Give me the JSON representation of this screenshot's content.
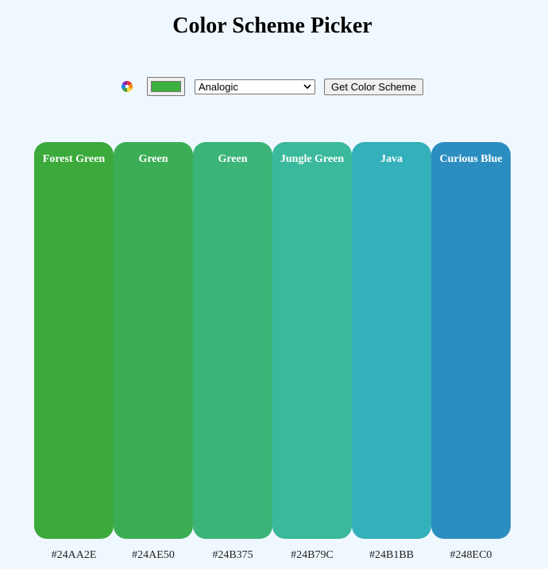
{
  "page": {
    "title": "Color Scheme Picker"
  },
  "controls": {
    "icon": "color-wheel-icon",
    "color_value": "#3BAF3F",
    "mode_selected": "Analogic",
    "button_label": "Get Color Scheme"
  },
  "scheme": {
    "colors": [
      {
        "name": "Forest Green",
        "hex": "#24AA2E",
        "swatch": "#3BAA3B"
      },
      {
        "name": "Green",
        "hex": "#24AE50",
        "swatch": "#3BAE55"
      },
      {
        "name": "Green",
        "hex": "#24B375",
        "swatch": "#3BB478"
      },
      {
        "name": "Jungle Green",
        "hex": "#24B79C",
        "swatch": "#3BB99C"
      },
      {
        "name": "Java",
        "hex": "#24B1BB",
        "swatch": "#33B0BA"
      },
      {
        "name": "Curious Blue",
        "hex": "#248EC0",
        "swatch": "#2C8EC0"
      }
    ]
  }
}
